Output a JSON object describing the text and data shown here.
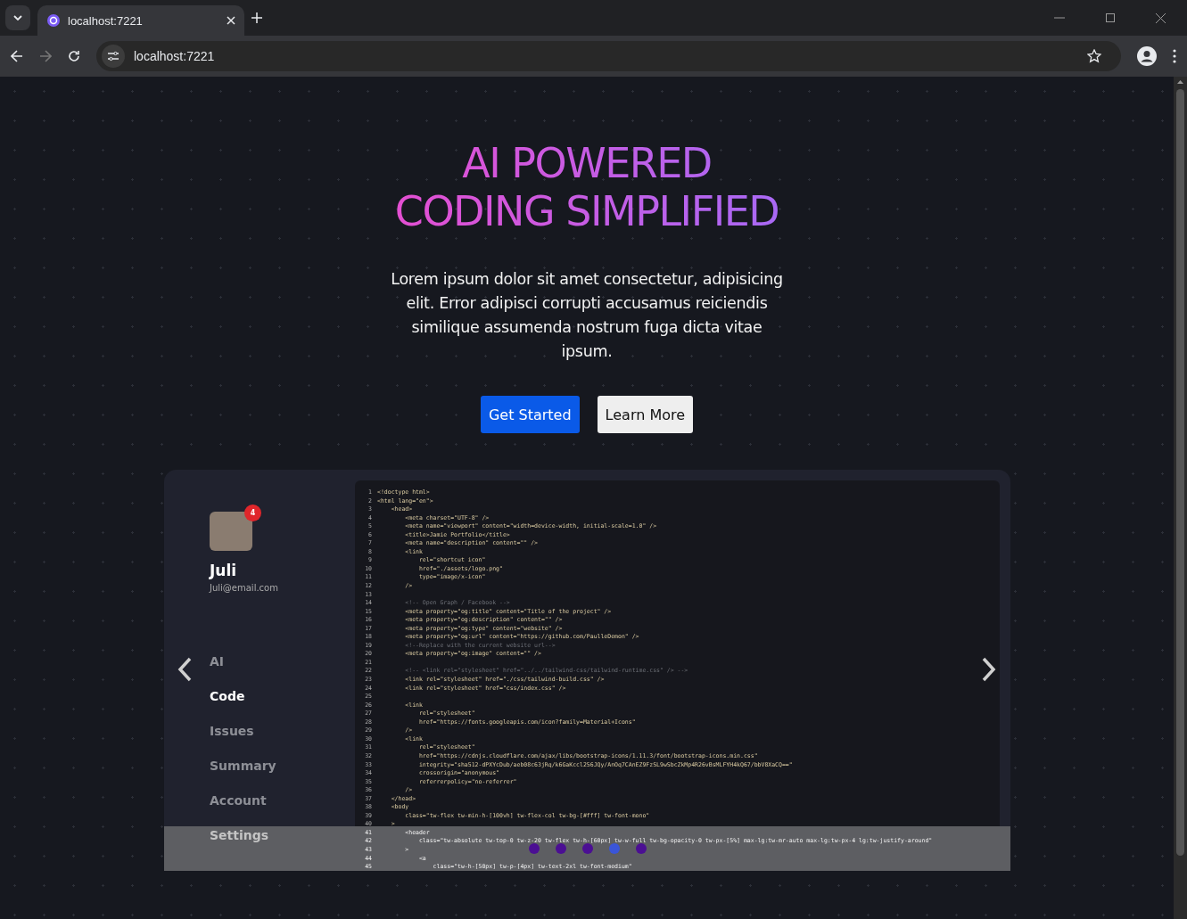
{
  "browser": {
    "tab_title": "localhost:7221",
    "address": "localhost:7221"
  },
  "hero": {
    "title_lines": [
      "AI POWERED",
      "CODING SIMPLIFIED"
    ],
    "description": "Lorem ipsum dolor sit amet consectetur, adipisicing elit. Error adipisci corrupti accusamus reiciendis similique assumenda nostrum fuga dicta vitae ipsum.",
    "buttons": [
      {
        "label": "Get Started",
        "kind": "primary"
      },
      {
        "label": "Learn More",
        "kind": "secondary"
      }
    ]
  },
  "showcase": {
    "profile": {
      "name": "Juli",
      "email": "Juli@email.com",
      "badge": "4"
    },
    "nav": [
      {
        "label": "AI",
        "selected": false
      },
      {
        "label": "Code",
        "selected": true
      },
      {
        "label": "Issues",
        "selected": false
      },
      {
        "label": "Summary",
        "selected": false
      },
      {
        "label": "Account",
        "selected": false
      },
      {
        "label": "Settings",
        "selected": false
      }
    ],
    "code_lines": [
      {
        "number": "1",
        "text": "<!doctype html>",
        "kind": "code"
      },
      {
        "number": "2",
        "text": "<html lang=\"en\">",
        "kind": "code"
      },
      {
        "number": "3",
        "text": "    <head>",
        "kind": "code"
      },
      {
        "number": "4",
        "text": "        <meta charset=\"UTF-8\" />",
        "kind": "code"
      },
      {
        "number": "5",
        "text": "        <meta name=\"viewport\" content=\"width=device-width, initial-scale=1.0\" />",
        "kind": "code"
      },
      {
        "number": "6",
        "text": "        <title>Jamie Portfolio</title>",
        "kind": "code"
      },
      {
        "number": "7",
        "text": "        <meta name=\"description\" content=\"\" />",
        "kind": "code"
      },
      {
        "number": "8",
        "text": "        <link",
        "kind": "code"
      },
      {
        "number": "9",
        "text": "            rel=\"shortcut icon\"",
        "kind": "code"
      },
      {
        "number": "10",
        "text": "            href=\"./assets/logo.png\"",
        "kind": "code"
      },
      {
        "number": "11",
        "text": "            type=\"image/x-icon\"",
        "kind": "code"
      },
      {
        "number": "12",
        "text": "        />",
        "kind": "code"
      },
      {
        "number": "13"
      },
      {
        "number": "14",
        "text": "        <!-- Open Graph / Facebook -->",
        "kind": "comment"
      },
      {
        "number": "15",
        "text": "        <meta property=\"og:title\" content=\"Title of the project\" />",
        "kind": "code"
      },
      {
        "number": "16",
        "text": "        <meta property=\"og:description\" content=\"\" />",
        "kind": "code"
      },
      {
        "number": "17",
        "text": "        <meta property=\"og:type\" content=\"website\" />",
        "kind": "code"
      },
      {
        "number": "18",
        "text": "        <meta property=\"og:url\" content=\"https://github.com/PaulleDemon\" />",
        "kind": "code"
      },
      {
        "number": "19",
        "text": "        <!--Replace with the current website url-->",
        "kind": "comment"
      },
      {
        "number": "20",
        "text": "        <meta property=\"og:image\" content=\"\" />",
        "kind": "code"
      },
      {
        "number": "21"
      },
      {
        "number": "22",
        "text": "        <!-- <link rel=\"stylesheet\" href=\"../../tailwind-css/tailwind-runtime.css\" /> -->",
        "kind": "comment"
      },
      {
        "number": "23",
        "text": "        <link rel=\"stylesheet\" href=\"./css/tailwind-build.css\" />",
        "kind": "code"
      },
      {
        "number": "24",
        "text": "        <link rel=\"stylesheet\" href=\"css/index.css\" />",
        "kind": "code"
      },
      {
        "number": "25"
      },
      {
        "number": "26",
        "text": "        <link",
        "kind": "code"
      },
      {
        "number": "27",
        "text": "            rel=\"stylesheet\"",
        "kind": "code"
      },
      {
        "number": "28",
        "text": "            href=\"https://fonts.googleapis.com/icon?family=Material+Icons\"",
        "kind": "code"
      },
      {
        "number": "29",
        "text": "        />",
        "kind": "code"
      },
      {
        "number": "30",
        "text": "        <link",
        "kind": "code"
      },
      {
        "number": "31",
        "text": "            rel=\"stylesheet\"",
        "kind": "code"
      },
      {
        "number": "32",
        "text": "            href=\"https://cdnjs.cloudflare.com/ajax/libs/bootstrap-icons/1.11.3/font/bootstrap-icons.min.css\"",
        "kind": "code"
      },
      {
        "number": "33",
        "text": "            integrity=\"sha512-dPXYcDub/aeb08c63jRq/k6GaKccl256JQy/AnOq7CAnEZ9FzSL9wSbcZkMp4R26vBsMLFYH4kQ67/bbV8XaCQ==\"",
        "kind": "code"
      },
      {
        "number": "34",
        "text": "            crossorigin=\"anonymous\"",
        "kind": "code"
      },
      {
        "number": "35",
        "text": "            referrerpolicy=\"no-referrer\"",
        "kind": "code"
      },
      {
        "number": "36",
        "text": "        />",
        "kind": "code"
      },
      {
        "number": "37",
        "text": "    </head>",
        "kind": "code"
      },
      {
        "number": "38",
        "text": "    <body",
        "kind": "code"
      },
      {
        "number": "39",
        "text": "        class=\"tw-flex tw-min-h-[100vh] tw-flex-col tw-bg-[#fff] tw-font-mono\"",
        "kind": "code"
      },
      {
        "number": "40",
        "text": "    >",
        "kind": "code"
      },
      {
        "number": "41",
        "text": "        <header",
        "kind": "code"
      },
      {
        "number": "42",
        "text": "            class=\"tw-absolute tw-top-0 tw-z-20 tw-flex tw-h-[60px] tw-w-full tw-bg-opacity-0 tw-px-[5%] max-lg:tw-mr-auto max-lg:tw-px-4 lg:tw-justify-around\"",
        "kind": "code"
      },
      {
        "number": "43",
        "text": "        >",
        "kind": "code"
      },
      {
        "number": "44",
        "text": "            <a",
        "kind": "code"
      },
      {
        "number": "45",
        "text": "                class=\"tw-h-[50px] tw-p-[4px] tw-text-2xl tw-font-medium\"",
        "kind": "code"
      }
    ],
    "dots": [
      {
        "selected": false
      },
      {
        "selected": false
      },
      {
        "selected": false
      },
      {
        "selected": true
      },
      {
        "selected": false
      }
    ]
  }
}
